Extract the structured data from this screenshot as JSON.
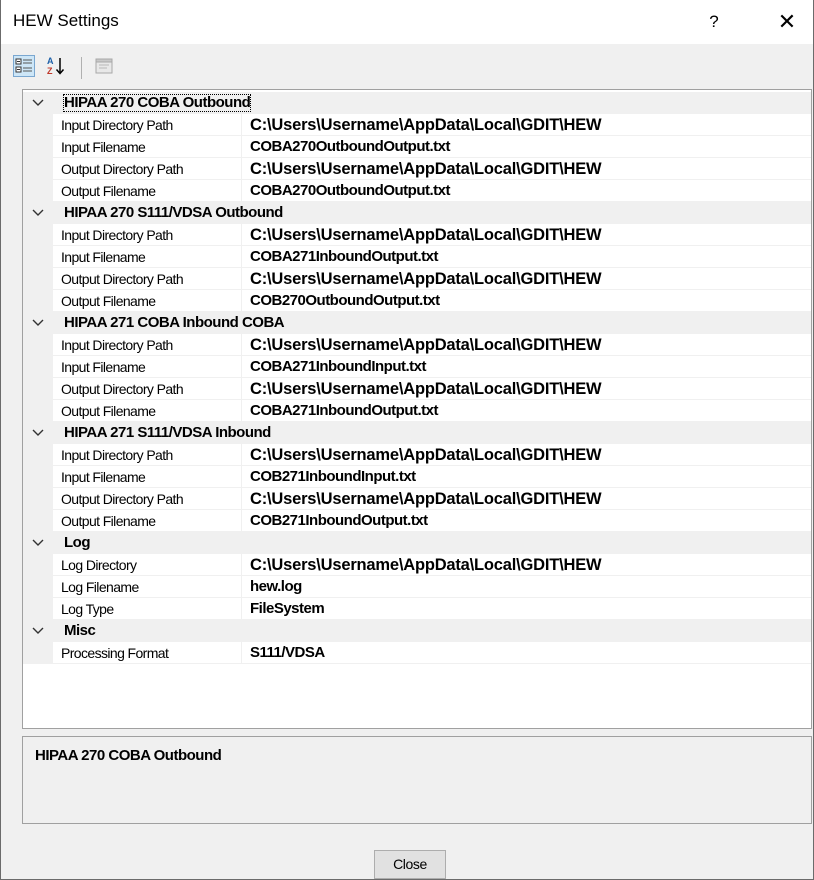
{
  "window": {
    "title": "HEW Settings",
    "help_label": "?",
    "close_glyph": "✕"
  },
  "toolbar": {
    "buttons": [
      {
        "name": "categorized-view",
        "icon": "categorized-icon"
      },
      {
        "name": "alphabetical-view",
        "icon": "sort-az-icon"
      },
      {
        "name": "property-pages",
        "icon": "property-pages-icon",
        "disabled": true
      }
    ]
  },
  "categories": [
    {
      "label": "HIPAA 270 COBA Outbound",
      "properties": [
        {
          "name": "Input Directory Path",
          "value": "C:\\Users\\Username\\AppData\\Local\\GDIT\\HEW"
        },
        {
          "name": "Input Filename",
          "value": "COBA270OutboundOutput.txt"
        },
        {
          "name": "Output Directory Path",
          "value": "C:\\Users\\Username\\AppData\\Local\\GDIT\\HEW"
        },
        {
          "name": "Output Filename",
          "value": "COBA270OutboundOutput.txt"
        }
      ]
    },
    {
      "label": "HIPAA 270 S111/VDSA Outbound",
      "properties": [
        {
          "name": "Input Directory Path",
          "value": "C:\\Users\\Username\\AppData\\Local\\GDIT\\HEW"
        },
        {
          "name": "Input Filename",
          "value": "COBA271InboundOutput.txt"
        },
        {
          "name": "Output Directory Path",
          "value": "C:\\Users\\Username\\AppData\\Local\\GDIT\\HEW"
        },
        {
          "name": "Output Filename",
          "value": "COB270OutboundOutput.txt"
        }
      ]
    },
    {
      "label": "HIPAA 271 COBA Inbound COBA",
      "properties": [
        {
          "name": "Input Directory Path",
          "value": "C:\\Users\\Username\\AppData\\Local\\GDIT\\HEW"
        },
        {
          "name": "Input Filename",
          "value": "COBA271InboundInput.txt"
        },
        {
          "name": "Output Directory Path",
          "value": "C:\\Users\\Username\\AppData\\Local\\GDIT\\HEW"
        },
        {
          "name": "Output Filename",
          "value": "COBA271InboundOutput.txt"
        }
      ]
    },
    {
      "label": "HIPAA 271 S111/VDSA Inbound",
      "properties": [
        {
          "name": "Input Directory Path",
          "value": "C:\\Users\\Username\\AppData\\Local\\GDIT\\HEW"
        },
        {
          "name": "Input Filename",
          "value": "COB271InboundInput.txt"
        },
        {
          "name": "Output Directory Path",
          "value": "C:\\Users\\Username\\AppData\\Local\\GDIT\\HEW"
        },
        {
          "name": "Output Filename",
          "value": "COB271InboundOutput.txt"
        }
      ]
    },
    {
      "label": "Log",
      "properties": [
        {
          "name": "Log Directory",
          "value": "C:\\Users\\Username\\AppData\\Local\\GDIT\\HEW"
        },
        {
          "name": "Log Filename",
          "value": "hew.log"
        },
        {
          "name": "Log Type",
          "value": "FileSystem"
        }
      ]
    },
    {
      "label": "Misc",
      "properties": [
        {
          "name": "Processing Format",
          "value": "S111/VDSA"
        }
      ]
    }
  ],
  "description": {
    "title": "HIPAA 270 COBA Outbound"
  },
  "footer": {
    "close_label": "Close"
  }
}
